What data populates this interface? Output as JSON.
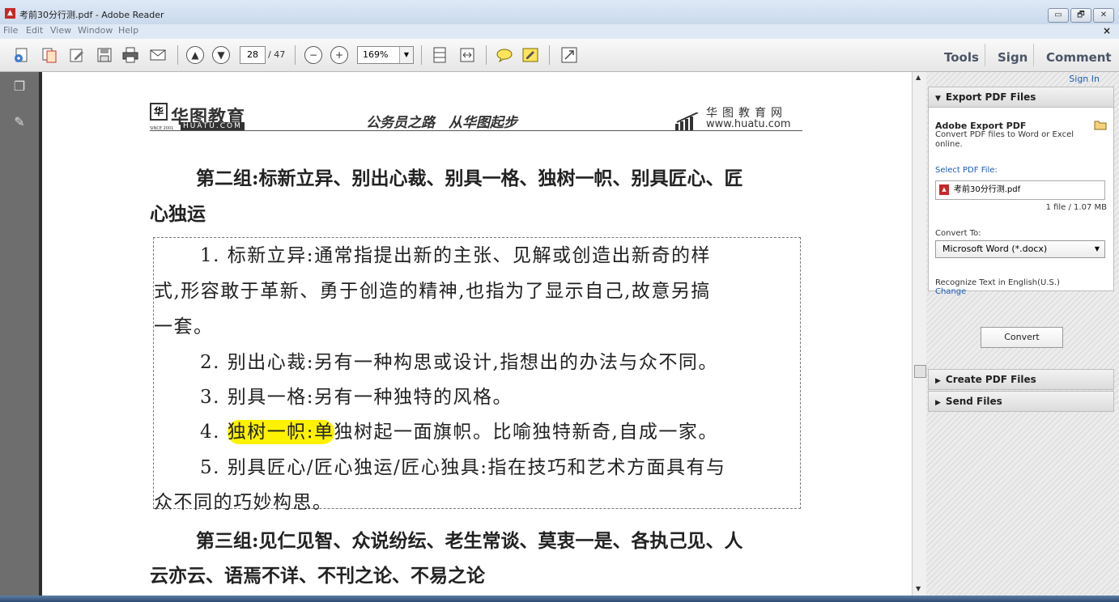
{
  "window": {
    "title": "考前30分行测.pdf - Adobe Reader",
    "minimize": "▭",
    "restore": "🗗",
    "close": "✕"
  },
  "menu": {
    "items": [
      "File",
      "Edit",
      "View",
      "Window",
      "Help"
    ],
    "close_doc": "×"
  },
  "toolbar": {
    "page_current": "28",
    "page_total": "/ 47",
    "zoom": "169%",
    "zoom_out": "−",
    "zoom_in": "+",
    "tabs": {
      "tools": "Tools",
      "sign": "Sign",
      "comment": "Comment"
    }
  },
  "document": {
    "header": {
      "logo_mark": "华",
      "logo_name": "华图教育",
      "logo_sub": "HUATU.COM",
      "since": "SINCE 2001",
      "slogan": "公务员之路　从华图起步",
      "right_cn": "华图教育网",
      "right_url": "www.huatu.com"
    },
    "group2_title_line1": "第二组:标新立异、别出心裁、别具一格、独树一帜、别具匠心、匠",
    "group2_title_line2": "心独运",
    "items": {
      "l1": "1. 标新立异:通常指提出新的主张、见解或创造出新奇的样",
      "l2": "式,形容敢于革新、勇于创造的精神,也指为了显示自己,故意另搞",
      "l3": "一套。",
      "l4": "2. 别出心裁:另有一种构思或设计,指想出的办法与众不同。",
      "l5": "3. 别具一格:另有一种独特的风格。",
      "l6_prefix": "4. ",
      "l6_highlight": "独树一帜:单",
      "l6_rest": "独树起一面旗帜。比喻独特新奇,自成一家。",
      "l7": "5. 别具匠心/匠心独运/匠心独具:指在技巧和艺术方面具有与",
      "l8": "众不同的巧妙构思。"
    },
    "group3_title_line1": "第三组:见仁见智、众说纷纭、老生常谈、莫衷一是、各执己见、人",
    "group3_title_line2": "云亦云、语焉不详、不刊之论、不易之论",
    "highlight_color": "#fff200"
  },
  "right_panel": {
    "sign_in": "Sign In",
    "export_title": "Export PDF Files",
    "adobe_export": "Adobe Export PDF",
    "export_desc": "Convert PDF files to Word or Excel online.",
    "select_label": "Select PDF File:",
    "file_name": "考前30分行测.pdf",
    "file_count": "1 file / 1.07 MB",
    "convert_to_label": "Convert To:",
    "convert_to_value": "Microsoft Word (*.docx)",
    "recognize": "Recognize Text in English(U.S.)",
    "change": "Change",
    "convert_button": "Convert",
    "create_title": "Create PDF Files",
    "send_title": "Send Files"
  }
}
